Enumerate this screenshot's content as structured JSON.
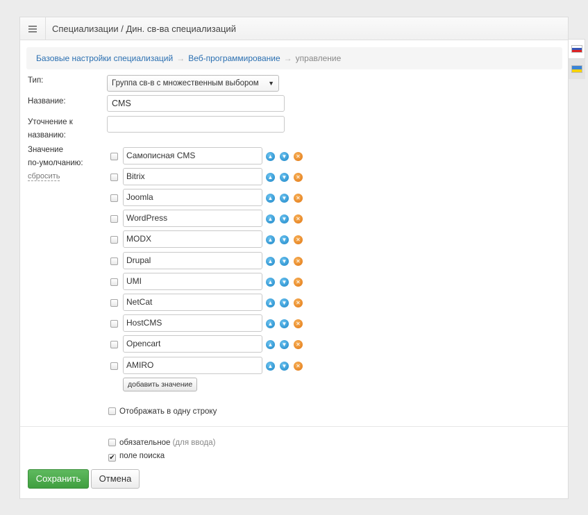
{
  "header": {
    "title": "Специализации / Дин. св-ва специализаций",
    "menu_icon": "hamburger-icon"
  },
  "breadcrumb": {
    "items": [
      "Базовые настройки специализаций",
      "Веб-программирование"
    ],
    "separator": "→",
    "current": "управление"
  },
  "form": {
    "type_label": "Тип:",
    "type_value": "Группа св-в с множественным выбором",
    "name_label": "Название:",
    "name_value": "CMS",
    "clarify_label_line1": "Уточнение к",
    "clarify_label_line2": "названию:",
    "clarify_value": "",
    "default_label_line1": "Значение",
    "default_label_line2": "по-умолчанию:",
    "reset_link": "сбросить",
    "values": [
      {
        "text": "Самописная CMS",
        "checked": false
      },
      {
        "text": "Bitrix",
        "checked": false
      },
      {
        "text": "Joomla",
        "checked": false
      },
      {
        "text": "WordPress",
        "checked": false
      },
      {
        "text": "MODX",
        "checked": false
      },
      {
        "text": "Drupal",
        "checked": false
      },
      {
        "text": "UMI",
        "checked": false
      },
      {
        "text": "NetCat",
        "checked": false
      },
      {
        "text": "HostCMS",
        "checked": false
      },
      {
        "text": "Opencart",
        "checked": false
      },
      {
        "text": "AMIRO",
        "checked": false
      }
    ],
    "add_value_button": "добавить значение",
    "one_line_label": "Отображать в одну строку",
    "required_label": "обязательное",
    "required_hint": "(для ввода)",
    "search_field_label": "поле поиска",
    "search_field_checked": true
  },
  "actions": {
    "save": "Сохранить",
    "cancel": "Отмена"
  },
  "colors": {
    "save_green": "#4cae4c",
    "link_blue": "#2a6fb1",
    "move_blue": "#1a84c6",
    "delete_orange": "#e07511"
  },
  "icons": {
    "move_up": "arrow-up-circle-icon",
    "move_down": "arrow-down-circle-icon",
    "delete": "close-circle-icon",
    "lang_ru": "flag-ru-icon",
    "lang_ua": "flag-ua-icon"
  }
}
